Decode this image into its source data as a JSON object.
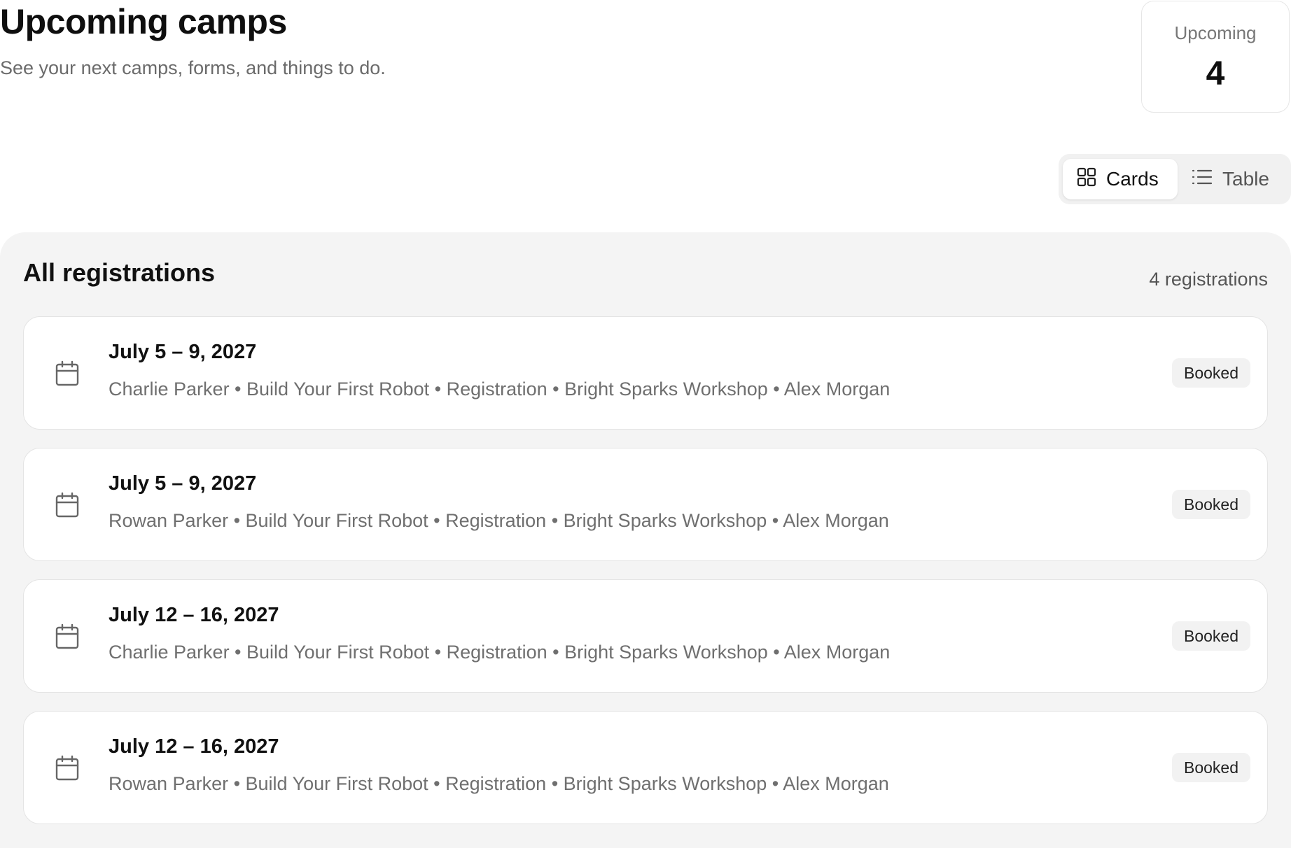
{
  "header": {
    "title": "Upcoming camps",
    "subtitle": "See your next camps, forms, and things to do."
  },
  "stat": {
    "label": "Upcoming",
    "value": "4"
  },
  "view_toggle": {
    "cards_label": "Cards",
    "table_label": "Table",
    "selected": "Cards",
    "cards_icon": "grid-icon",
    "table_icon": "list-icon"
  },
  "registrations": {
    "title": "All registrations",
    "count_label": "4 registrations",
    "item_icon": "calendar-icon",
    "items": [
      {
        "date": "July 5 – 9, 2027",
        "details": "Charlie Parker • Build Your First Robot • Registration • Bright Sparks Workshop • Alex Morgan",
        "status": "Booked"
      },
      {
        "date": "July 5 – 9, 2027",
        "details": "Rowan Parker • Build Your First Robot • Registration • Bright Sparks Workshop • Alex Morgan",
        "status": "Booked"
      },
      {
        "date": "July 12 – 16, 2027",
        "details": "Charlie Parker • Build Your First Robot • Registration • Bright Sparks Workshop • Alex Morgan",
        "status": "Booked"
      },
      {
        "date": "July 12 – 16, 2027",
        "details": "Rowan Parker • Build Your First Robot • Registration • Bright Sparks Workshop • Alex Morgan",
        "status": "Booked"
      }
    ]
  },
  "colors": {
    "panel_background": "#f4f4f4",
    "card_border": "#e4e4e4",
    "muted_text": "#6f6f6f",
    "badge_background": "#f2f2f2"
  }
}
